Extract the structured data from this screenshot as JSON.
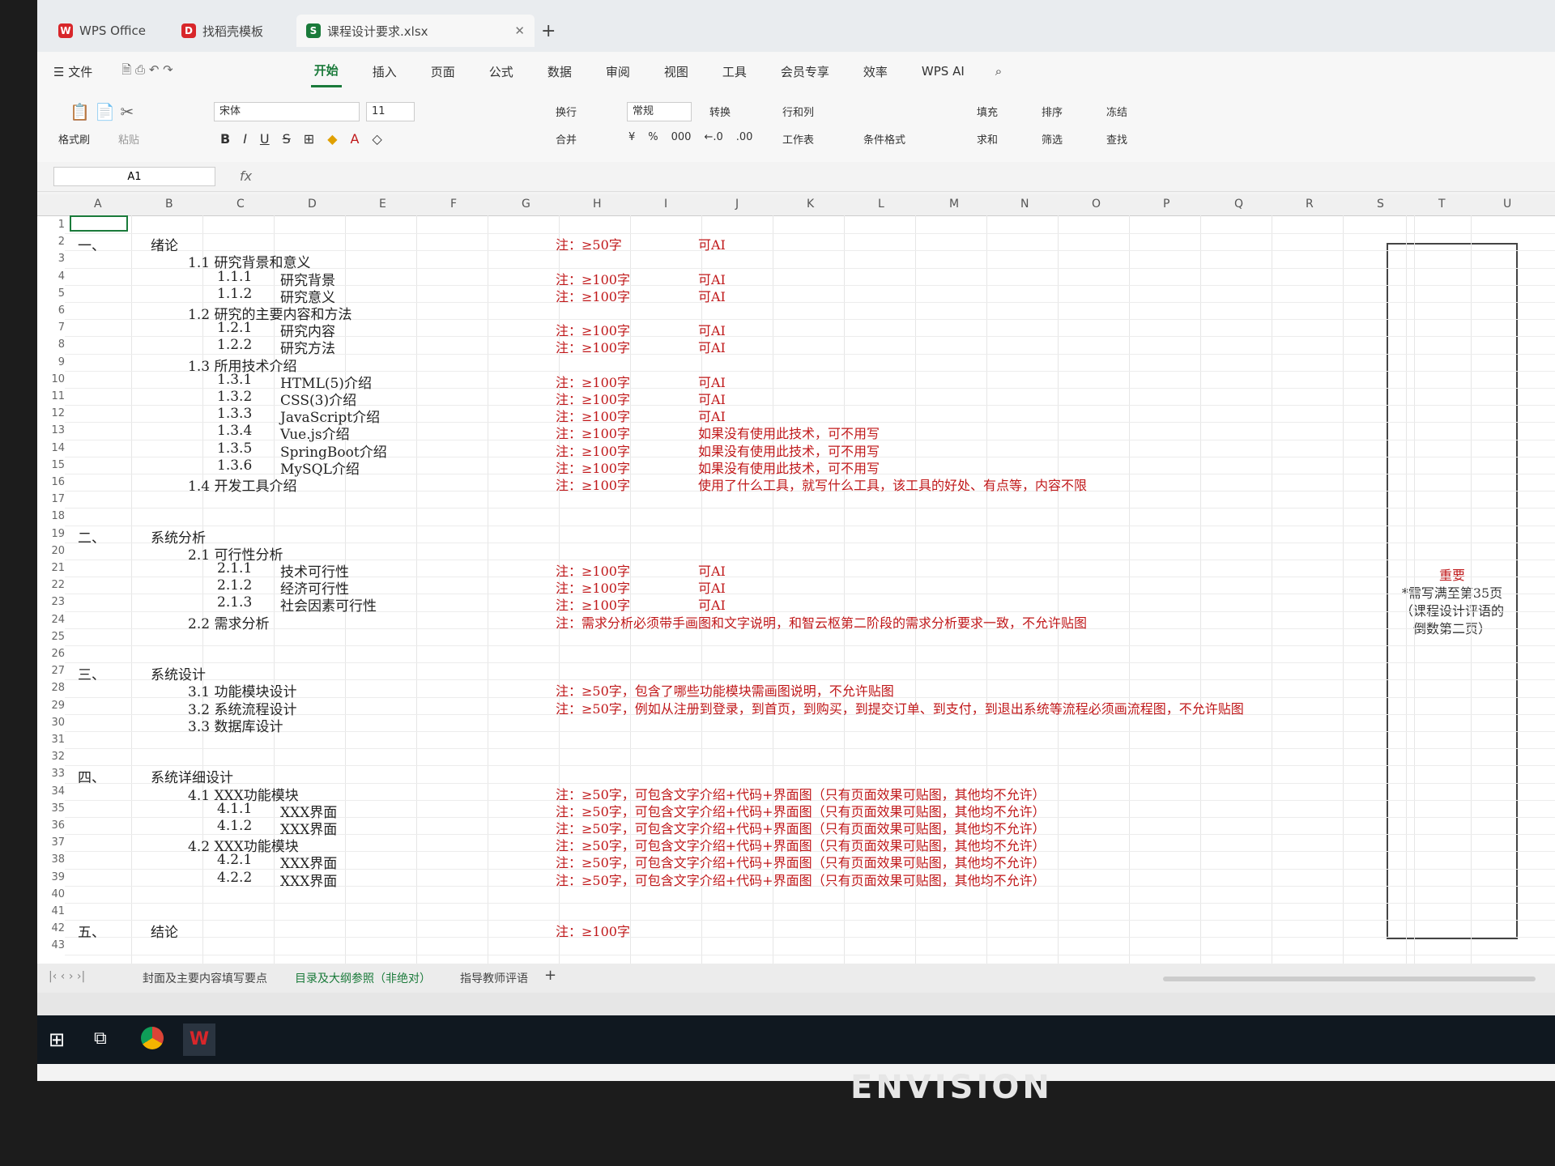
{
  "window": {
    "tabs": [
      {
        "label": "WPS Office"
      },
      {
        "label": "找稻壳模板"
      },
      {
        "label": "课程设计要求.xlsx"
      }
    ],
    "new_tab": "+"
  },
  "menu": {
    "file": "文件",
    "items": [
      "开始",
      "插入",
      "页面",
      "公式",
      "数据",
      "审阅",
      "视图",
      "工具",
      "会员专享",
      "效率"
    ],
    "ai": "WPS AI"
  },
  "ribbon": {
    "format_painter": "格式刷",
    "paste": "粘贴",
    "font": "宋体",
    "size": "11",
    "wrap": "换行",
    "number_format": "常规",
    "convert": "转换",
    "rowcol": "行和列",
    "merge": "合并",
    "worksheet": "工作表",
    "cond_format": "条件格式",
    "fill": "填充",
    "sort": "排序",
    "freeze": "冻结",
    "sum": "求和",
    "filter": "筛选",
    "find": "查找"
  },
  "formula_bar": {
    "cell": "A1",
    "fx": "fx"
  },
  "columns": [
    "A",
    "B",
    "C",
    "D",
    "E",
    "F",
    "G",
    "H",
    "I",
    "J",
    "K",
    "L",
    "M",
    "N",
    "O",
    "P",
    "Q",
    "R",
    "S",
    "T",
    "U"
  ],
  "rows": [
    {
      "n": "1"
    },
    {
      "n": "2",
      "num": "一、",
      "title": "绪论",
      "note": "注：≥50字",
      "ai": "可AI"
    },
    {
      "n": "3",
      "sec": "1.1 研究背景和意义"
    },
    {
      "n": "4",
      "sub": "1.1.1",
      "subt": "研究背景",
      "note": "注：≥100字",
      "ai": "可AI"
    },
    {
      "n": "5",
      "sub": "1.1.2",
      "subt": "研究意义",
      "note": "注：≥100字",
      "ai": "可AI"
    },
    {
      "n": "6",
      "sec": "1.2 研究的主要内容和方法"
    },
    {
      "n": "7",
      "sub": "1.2.1",
      "subt": "研究内容",
      "note": "注：≥100字",
      "ai": "可AI"
    },
    {
      "n": "8",
      "sub": "1.2.2",
      "subt": "研究方法",
      "note": "注：≥100字",
      "ai": "可AI"
    },
    {
      "n": "9",
      "sec": "1.3 所用技术介绍"
    },
    {
      "n": "10",
      "sub": "1.3.1",
      "subt": "HTML(5)介绍",
      "note": "注：≥100字",
      "ai": "可AI"
    },
    {
      "n": "11",
      "sub": "1.3.2",
      "subt": "CSS(3)介绍",
      "note": "注：≥100字",
      "ai": "可AI"
    },
    {
      "n": "12",
      "sub": "1.3.3",
      "subt": "JavaScript介绍",
      "note": "注：≥100字",
      "ai": "可AI"
    },
    {
      "n": "13",
      "sub": "1.3.4",
      "subt": "Vue.js介绍",
      "note": "注：≥100字",
      "ai": "如果没有使用此技术，可不用写"
    },
    {
      "n": "14",
      "sub": "1.3.5",
      "subt": "SpringBoot介绍",
      "note": "注：≥100字",
      "ai": "如果没有使用此技术，可不用写"
    },
    {
      "n": "15",
      "sub": "1.3.6",
      "subt": "MySQL介绍",
      "note": "注：≥100字",
      "ai": "如果没有使用此技术，可不用写"
    },
    {
      "n": "16",
      "sec": "1.4 开发工具介绍",
      "note": "注：≥100字",
      "ai": "使用了什么工具，就写什么工具，该工具的好处、有点等，内容不限"
    },
    {
      "n": "17"
    },
    {
      "n": "18"
    },
    {
      "n": "19",
      "num": "二、",
      "title": "系统分析"
    },
    {
      "n": "20",
      "sec": "2.1 可行性分析"
    },
    {
      "n": "21",
      "sub": "2.1.1",
      "subt": "技术可行性",
      "note": "注：≥100字",
      "ai": "可AI"
    },
    {
      "n": "22",
      "sub": "2.1.2",
      "subt": "经济可行性",
      "note": "注：≥100字",
      "ai": "可AI"
    },
    {
      "n": "23",
      "sub": "2.1.3",
      "subt": "社会因素可行性",
      "note": "注：≥100字",
      "ai": "可AI"
    },
    {
      "n": "24",
      "sec": "2.2 需求分析",
      "note": "注：需求分析必须带手画图和文字说明，和智云枢第二阶段的需求分析要求一致，不允许贴图"
    },
    {
      "n": "25"
    },
    {
      "n": "26"
    },
    {
      "n": "27",
      "num": "三、",
      "title": "系统设计"
    },
    {
      "n": "28",
      "sec": "3.1 功能模块设计",
      "note": "注：≥50字，包含了哪些功能模块需画图说明，不允许贴图"
    },
    {
      "n": "29",
      "sec": "3.2 系统流程设计",
      "note": "注：≥50字，例如从注册到登录，到首页，到购买，到提交订单、到支付，到退出系统等流程必须画流程图，不允许贴图"
    },
    {
      "n": "30",
      "sec": "3.3 数据库设计"
    },
    {
      "n": "31"
    },
    {
      "n": "32"
    },
    {
      "n": "33",
      "num": "四、",
      "title": "系统详细设计"
    },
    {
      "n": "34",
      "sec": "4.1 XXX功能模块",
      "note": "注：≥50字，可包含文字介绍+代码+界面图（只有页面效果可贴图，其他均不允许）"
    },
    {
      "n": "35",
      "sub": "4.1.1",
      "subt": "XXX界面",
      "note": "注：≥50字，可包含文字介绍+代码+界面图（只有页面效果可贴图，其他均不允许）"
    },
    {
      "n": "36",
      "sub": "4.1.2",
      "subt": "XXX界面",
      "note": "注：≥50字，可包含文字介绍+代码+界面图（只有页面效果可贴图，其他均不允许）"
    },
    {
      "n": "37",
      "sec": "4.2 XXX功能模块",
      "note": "注：≥50字，可包含文字介绍+代码+界面图（只有页面效果可贴图，其他均不允许）"
    },
    {
      "n": "38",
      "sub": "4.2.1",
      "subt": "XXX界面",
      "note": "注：≥50字，可包含文字介绍+代码+界面图（只有页面效果可贴图，其他均不允许）"
    },
    {
      "n": "39",
      "sub": "4.2.2",
      "subt": "XXX界面",
      "note": "注：≥50字，可包含文字介绍+代码+界面图（只有页面效果可贴图，其他均不允许）"
    },
    {
      "n": "40"
    },
    {
      "n": "41"
    },
    {
      "n": "42",
      "num": "五、",
      "title": "结论",
      "note": "注：≥100字"
    },
    {
      "n": "43"
    }
  ],
  "side_note": {
    "title": "重要",
    "line1": "*需写满至第35页",
    "line2": "（课程设计评语的",
    "line3": "倒数第二页）"
  },
  "sheets": [
    "封面及主要内容填写要点",
    "目录及大纲参照（非绝对）",
    "指导教师评语"
  ],
  "active_sheet": 1,
  "monitor_brand": "ENVISION",
  "colors": {
    "accent": "#1a7a3a",
    "note": "#c0181a"
  }
}
